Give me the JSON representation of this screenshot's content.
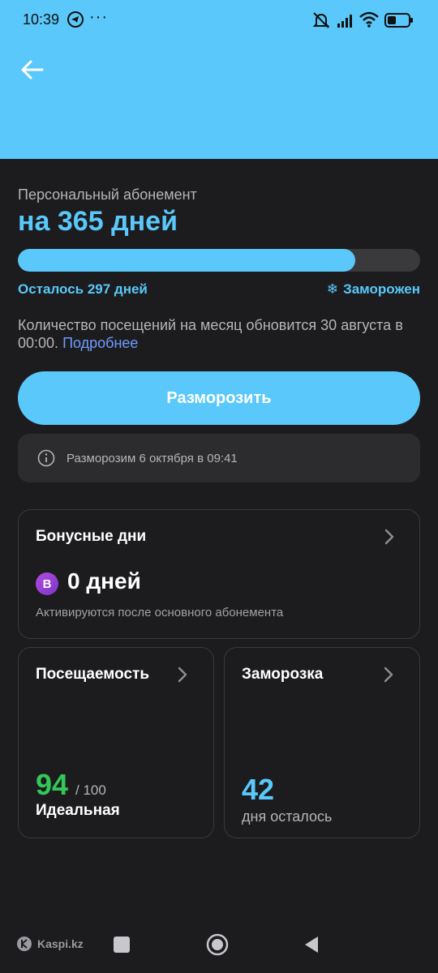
{
  "status_bar": {
    "time": "10:39",
    "dots": "···",
    "icons": [
      "telegram-icon",
      "mute-icon",
      "signal-icon",
      "wifi-icon",
      "battery-icon"
    ]
  },
  "header": {
    "back_icon": "arrow-left-icon",
    "background_color": "#5ac8fa"
  },
  "subscription": {
    "subtitle": "Персональный абонемент",
    "title": "на 365 дней",
    "progress_fraction": 0.838,
    "remaining": "Осталось 297 дней",
    "frozen_status": "Заморожен",
    "frozen_icon": "snowflake-icon",
    "visits_info": "Количество посещений на месяц обновится 30 августа в 00:00.",
    "more_link": "Подробнее"
  },
  "unfreeze_button": "Разморозить",
  "notice": {
    "icon": "info-icon",
    "text": "Разморозим 6 октября в 09:41"
  },
  "bonus": {
    "title": "Бонусные дни",
    "badge": "B",
    "days": "0 дней",
    "hint": "Активируются после основного абонемента"
  },
  "attendance": {
    "title": "Посещаемость",
    "score": "94",
    "max": "/ 100",
    "label": "Идеальная"
  },
  "freeze": {
    "title": "Заморозка",
    "value": "42",
    "label": "дня осталось"
  },
  "nav": {
    "watermark": "Kaspi.kz"
  },
  "colors": {
    "accent": "#5ac8fa",
    "background": "#1c1c1e",
    "card": "#2c2c2e",
    "success": "#34c759",
    "link": "#6e9cff"
  }
}
